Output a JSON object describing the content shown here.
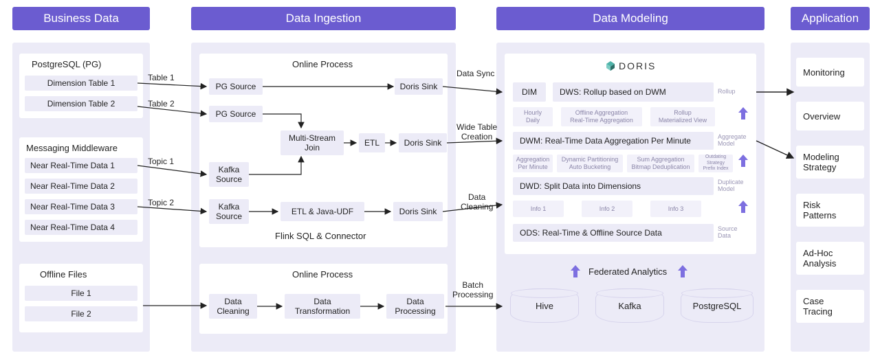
{
  "headers": {
    "business_data": "Business Data",
    "ingestion": "Data Ingestion",
    "modeling": "Data Modeling",
    "application": "Application"
  },
  "business": {
    "pg_title": "PostgreSQL (PG)",
    "dim1": "Dimension Table 1",
    "dim2": "Dimension Table 2",
    "mm_title": "Messaging Middleware",
    "nrt1": "Near Real-Time Data 1",
    "nrt2": "Near Real-Time Data 2",
    "nrt3": "Near Real-Time Data 3",
    "nrt4": "Near Real-Time Data 4",
    "offline_title": "Offline Files",
    "file1": "File 1",
    "file2": "File 2"
  },
  "inter_labels": {
    "table1": "Table 1",
    "table2": "Table 2",
    "topic1": "Topic 1",
    "topic2": "Topic 2",
    "data_sync": "Data Sync",
    "wide_table": "Wide Table\nCreation",
    "data_cleaning": "Data\nCleaning",
    "batch_processing": "Batch\nProcessing"
  },
  "ingestion": {
    "online_title": "Online Process",
    "pg_source": "PG Source",
    "kafka_source": "Kafka\nSource",
    "multi_stream": "Multi-Stream\nJoin",
    "etl": "ETL",
    "etl_udf": "ETL & Java-UDF",
    "doris_sink": "Doris Sink",
    "flink_footer": "Flink SQL & Connector",
    "offline_title": "Online Process",
    "data_cleaning": "Data\nCleaning",
    "data_transformation": "Data\nTransformation",
    "data_processing": "Data\nProcessing"
  },
  "modeling": {
    "doris": "DORIS",
    "dim": "DIM",
    "dws": "DWS: Rollup based on DWM",
    "dws_side": "Rollup",
    "row1": {
      "a": "Hourly\nDaily",
      "b": "Offline Aggregation\nReal-Time Aggregation",
      "c": "Rollup\nMaterialized View"
    },
    "dwm": "DWM: Real-Time Data Aggregation Per Minute",
    "dwm_side": "Aggregate\nModel",
    "row2": {
      "a": "Aggregation\nPer Minute",
      "b": "Dynamic Partitioning\nAuto Bucketing",
      "c": "Sum Aggregation\nBitmap Deduplication",
      "d": "Outdating Strategy\nPrefix Index"
    },
    "dwd": "DWD: Split Data into Dimensions",
    "dwd_side": "Duplicate\nModel",
    "row3": {
      "a": "Info 1",
      "b": "Info 2",
      "c": "Info 3"
    },
    "ods": "ODS: Real-Time & Offline Source Data",
    "ods_side": "Source\nData",
    "federated": "Federated Analytics",
    "hive": "Hive",
    "kafka": "Kafka",
    "postgres": "PostgreSQL"
  },
  "application": {
    "monitoring": "Monitoring",
    "overview": "Overview",
    "modeling_strategy": "Modeling\nStrategy",
    "risk_patterns": "Risk\nPatterns",
    "adhoc": "Ad-Hoc\nAnalysis",
    "case_tracing": "Case\nTracing"
  }
}
